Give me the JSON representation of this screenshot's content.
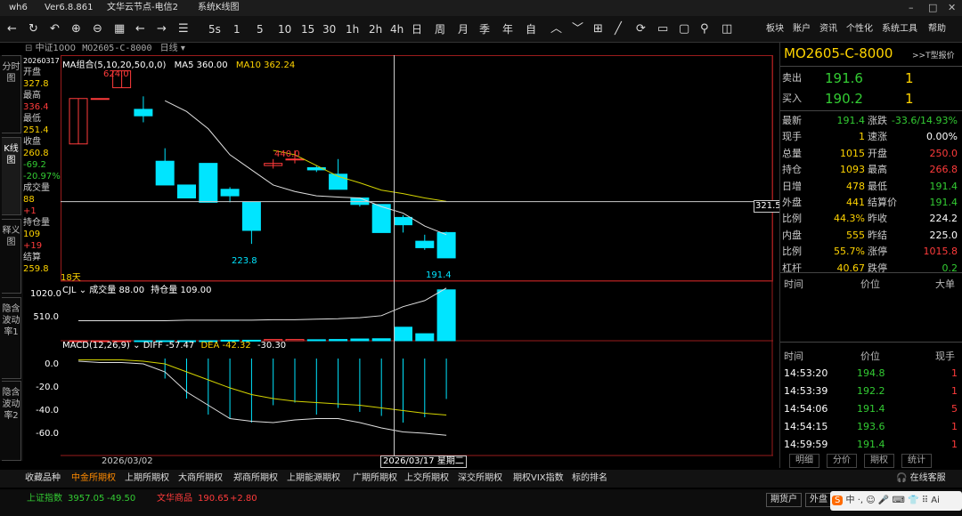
{
  "app": {
    "name": "wh6",
    "version": "Ver6.8.861",
    "server": "文华云节点-电信2",
    "view": "系统K线图"
  },
  "toolbar": {
    "buttons": [
      "5s",
      "1",
      "5",
      "10",
      "15",
      "30",
      "1h",
      "2h",
      "4h",
      "日",
      "周",
      "月",
      "季",
      "年",
      "自"
    ],
    "menus": [
      "板块",
      "账户",
      "资讯",
      "个性化",
      "系统工具",
      "帮助"
    ]
  },
  "header": {
    "index_label": "中证1000",
    "contract_code": "MO2605-C-8000",
    "period": "日线"
  },
  "side_tabs": [
    "分时图",
    "K线图",
    "释义图",
    "隐含波动率1",
    "隐含波动率2"
  ],
  "info": {
    "date": "20260317",
    "open_label": "开盘",
    "open": "327.8",
    "high_label": "最高",
    "high": "336.4",
    "low_label": "最低",
    "low": "251.4",
    "close_label": "收盘",
    "close": "260.8",
    "change": "-69.2",
    "change_pct": "-20.97%",
    "volume_label": "成交量",
    "volume": "88",
    "volume_change": "+1",
    "oi_label": "持仓量",
    "oi": "109",
    "oi_change": "+19",
    "settle_label": "结算",
    "settle": "259.8"
  },
  "main_legend": {
    "ma_group": "MA组合(5,10,20,50,0,0)",
    "ma5": "MA5 360.00",
    "ma10": "MA10 362.24"
  },
  "annotations": {
    "high_label": "624.0",
    "mid_label": "440.0",
    "low_label": "223.8",
    "last_label": "191.4",
    "days": "18天",
    "crosshair_price": "321.5"
  },
  "volume_legend": {
    "name": "CJL",
    "volume": "成交量 88.00",
    "oi": "持仓量 109.00"
  },
  "volume_axis": [
    "1020.0",
    "510.0"
  ],
  "macd_legend": {
    "name": "MACD(12,26,9)",
    "diff": "DIFF -57.47",
    "dea": "DEA -42.32",
    "macd": "-30.30"
  },
  "macd_axis": [
    "0.0",
    "-20.0",
    "-40.0",
    "-60.0"
  ],
  "x_axis": {
    "left_date": "2026/03/02",
    "cursor_date": "2026/03/17 星期二"
  },
  "quote": {
    "contract": "MO2605-C-8000",
    "type_label": ">>T型报价",
    "ask_label": "卖出",
    "ask": "191.6",
    "ask_vol": "1",
    "bid_label": "买入",
    "bid": "190.2",
    "bid_vol": "1",
    "rows": [
      {
        "l1": "最新",
        "v1": "191.4",
        "c1": "grn",
        "l2": "涨跌",
        "v2": "-33.6/14.93%",
        "c2": "grn"
      },
      {
        "l1": "现手",
        "v1": "1",
        "c1": "yel",
        "l2": "速涨",
        "v2": "0.00%",
        "c2": "wht"
      },
      {
        "l1": "总量",
        "v1": "1015",
        "c1": "yel",
        "l2": "开盘",
        "v2": "250.0",
        "c2": "red"
      },
      {
        "l1": "持仓",
        "v1": "1093",
        "c1": "yel",
        "l2": "最高",
        "v2": "266.8",
        "c2": "red"
      },
      {
        "l1": "日增",
        "v1": "478",
        "c1": "yel",
        "l2": "最低",
        "v2": "191.4",
        "c2": "grn"
      },
      {
        "l1": "外盘",
        "v1": "441",
        "c1": "yel",
        "l2": "结算价",
        "v2": "191.4",
        "c2": "grn"
      },
      {
        "l1": "比例",
        "v1": "44.3%",
        "c1": "yel",
        "l2": "昨收",
        "v2": "224.2",
        "c2": "wht"
      },
      {
        "l1": "内盘",
        "v1": "555",
        "c1": "yel",
        "l2": "昨结",
        "v2": "225.0",
        "c2": "wht"
      },
      {
        "l1": "比例",
        "v1": "55.7%",
        "c1": "yel",
        "l2": "涨停",
        "v2": "1015.8",
        "c2": "red"
      },
      {
        "l1": "杠杆",
        "v1": "40.67",
        "c1": "yel",
        "l2": "跌停",
        "v2": "0.2",
        "c2": "grn"
      }
    ],
    "time_header": [
      "时间",
      "价位",
      "大单"
    ],
    "ticks_header": [
      "时间",
      "价位",
      "现手"
    ],
    "ticks": [
      {
        "t": "14:53:20",
        "p": "194.8",
        "v": "1"
      },
      {
        "t": "14:53:39",
        "p": "192.2",
        "v": "1"
      },
      {
        "t": "14:54:06",
        "p": "191.4",
        "v": "5"
      },
      {
        "t": "14:54:15",
        "p": "193.6",
        "v": "1"
      },
      {
        "t": "14:59:59",
        "p": "191.4",
        "v": "1"
      }
    ],
    "tabs": [
      "明细",
      "分价",
      "期权",
      "统计"
    ]
  },
  "bottom_tabs": [
    "收藏品种",
    "中金所期权",
    "上期所期权",
    "大商所期权",
    "郑商所期权",
    "上期能源期权",
    "广期所期权",
    "上交所期权",
    "深交所期权",
    "期权VIX指数",
    "标的排名"
  ],
  "status": {
    "idx1_label": "上证指数",
    "idx1_val": "3957.05",
    "idx1_chg": "-49.50",
    "idx2_label": "文华商品",
    "idx2_val": "190.65",
    "idx2_chg": "+2.80",
    "btn1": "期货户",
    "btn2": "外盘",
    "service": "在线客服"
  },
  "chart_data": {
    "type": "candlestick",
    "candles": [
      {
        "o": 455,
        "c": 560,
        "h": 560,
        "l": 455
      },
      {
        "o": 560,
        "c": 560,
        "h": 560,
        "l": 560
      },
      {
        "o": 585,
        "c": 624,
        "h": 624,
        "l": 585
      },
      {
        "o": 535,
        "c": 520,
        "h": 565,
        "l": 505
      },
      {
        "o": 415,
        "c": 360,
        "h": 445,
        "l": 360
      },
      {
        "o": 360,
        "c": 330,
        "h": 360,
        "l": 330
      },
      {
        "o": 410,
        "c": 320,
        "h": 410,
        "l": 320
      },
      {
        "o": 350,
        "c": 335,
        "h": 355,
        "l": 320
      },
      {
        "o": 320,
        "c": 255,
        "h": 320,
        "l": 223.8
      },
      {
        "o": 405,
        "c": 410,
        "h": 420,
        "l": 398
      },
      {
        "o": 420,
        "c": 420,
        "h": 440,
        "l": 410
      },
      {
        "o": 400,
        "c": 395,
        "h": 405,
        "l": 390
      },
      {
        "o": 385,
        "c": 350,
        "h": 420,
        "l": 350
      },
      {
        "o": 330,
        "c": 315,
        "h": 330,
        "l": 310
      },
      {
        "o": 315,
        "c": 250,
        "h": 315,
        "l": 250
      },
      {
        "o": 285,
        "c": 268,
        "h": 290,
        "l": 250
      },
      {
        "o": 230,
        "c": 215,
        "h": 245,
        "l": 210
      },
      {
        "o": 250,
        "c": 191.4,
        "h": 252,
        "l": 191.4
      }
    ],
    "ma5": [
      null,
      null,
      null,
      null,
      555,
      530,
      490,
      430,
      395,
      360,
      345,
      335,
      332,
      330,
      310,
      295,
      265,
      245
    ],
    "ma10": [
      null,
      null,
      null,
      null,
      null,
      null,
      null,
      null,
      null,
      440,
      430,
      405,
      380,
      365,
      348,
      340,
      330,
      322
    ],
    "ylim": [
      150,
      650
    ],
    "volume": [
      0,
      0,
      0,
      0,
      0,
      0,
      0,
      10,
      10,
      25,
      25,
      20,
      25,
      35,
      40,
      270,
      140,
      1015
    ],
    "volume_oi": [
      400,
      400,
      400,
      400,
      400,
      410,
      410,
      410,
      410,
      420,
      420,
      430,
      440,
      460,
      500,
      680,
      800,
      1050
    ],
    "volume_ylim": [
      0,
      1100
    ],
    "macd": [
      0,
      0,
      0,
      0,
      -15,
      -30,
      -42,
      -45,
      -48,
      -35,
      -33,
      -42,
      -37,
      -40,
      -43,
      -48,
      -44,
      -30.3
    ],
    "diff": [
      -2,
      -3,
      -3,
      -4,
      -10,
      -25,
      -35,
      -45,
      -47,
      -48,
      -46,
      -45,
      -45,
      -48,
      -52,
      -55,
      -56,
      -57.47
    ],
    "dea": [
      -1,
      -1,
      -1,
      -2,
      -4,
      -10,
      -16,
      -22,
      -27,
      -30,
      -32,
      -33,
      -34,
      -35,
      -37,
      -39,
      -41,
      -42.32
    ],
    "macd_ylim": [
      -70,
      10
    ]
  }
}
